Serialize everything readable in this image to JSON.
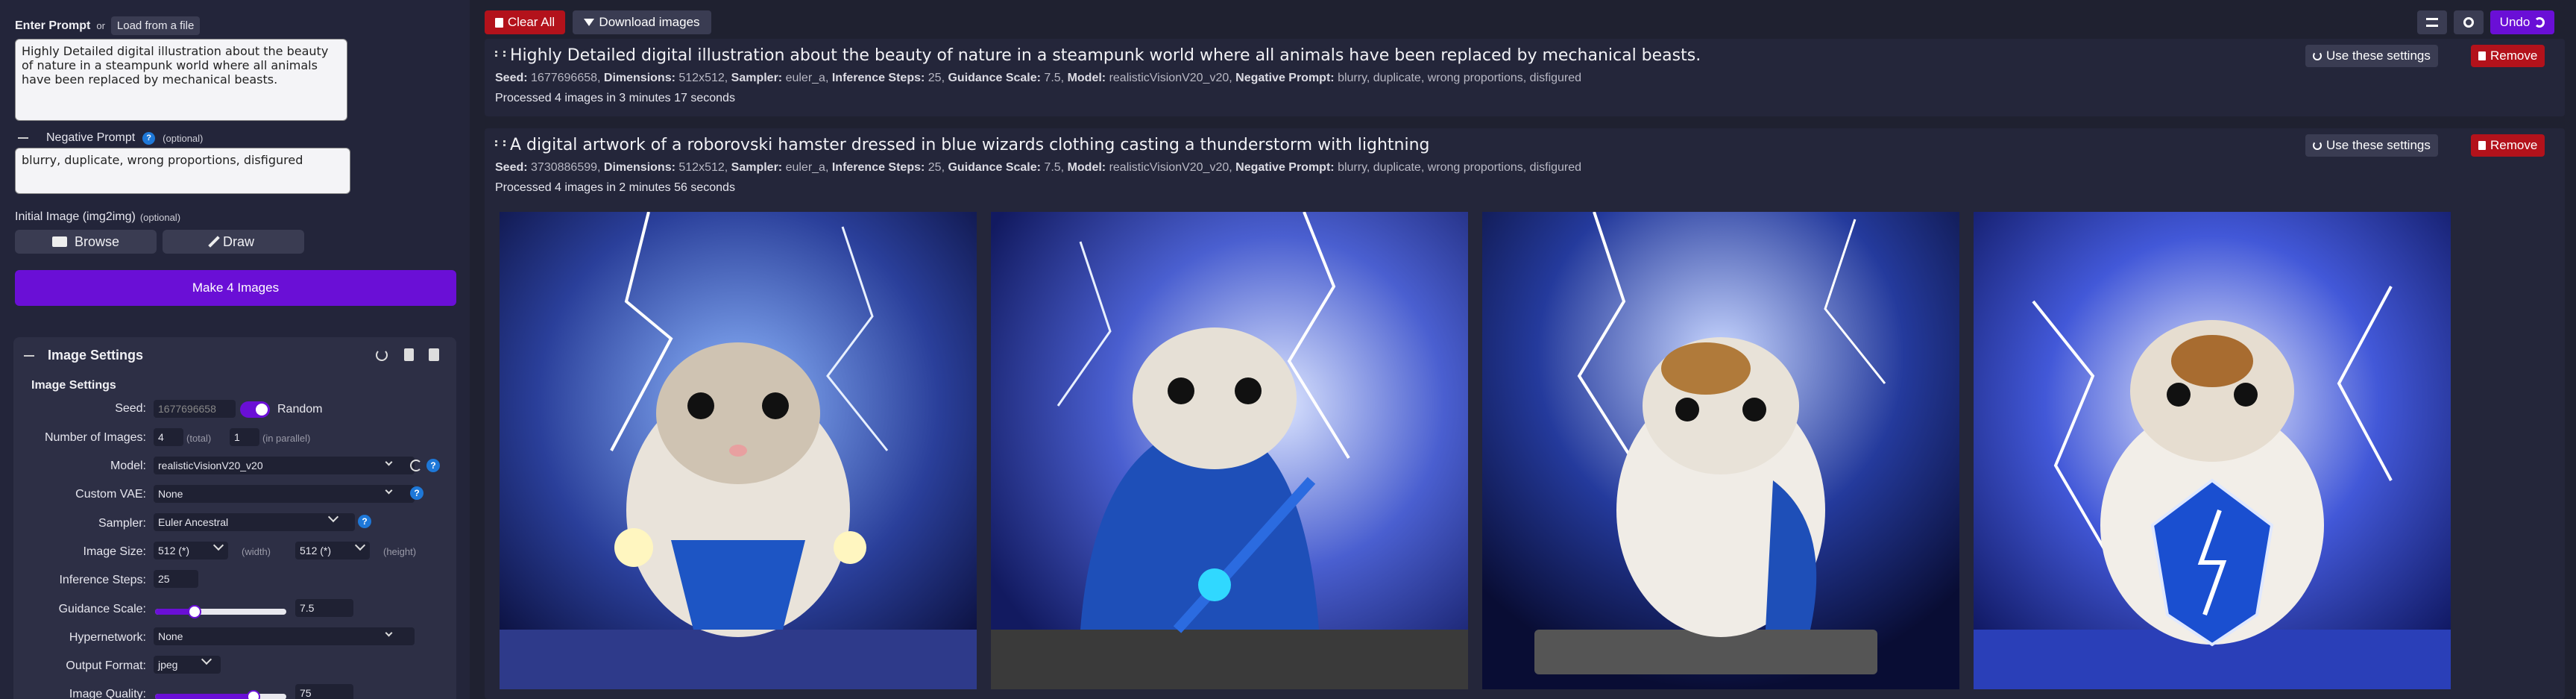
{
  "prompt": {
    "label": "Enter Prompt",
    "or": "or",
    "load_file": "Load from a file",
    "text": "Highly Detailed digital illustration about the beauty of nature in a steampunk world where all animals have been replaced by mechanical beasts."
  },
  "negative_prompt": {
    "label": "Negative Prompt",
    "optional": "(optional)",
    "text": "blurry, duplicate, wrong proportions, disfigured"
  },
  "init_image": {
    "label": "Initial Image (img2img)",
    "optional": "(optional)",
    "browse": "Browse",
    "draw": "Draw"
  },
  "make_button": "Make 4 Images",
  "image_settings": {
    "header": "Image Settings",
    "subheader": "Image Settings",
    "seed": {
      "label": "Seed:",
      "value": "1677696658",
      "toggle_label": "Random",
      "random_on": true
    },
    "num_images": {
      "label": "Number of Images:",
      "total": "4",
      "total_hint": "(total)",
      "parallel": "1",
      "parallel_hint": "(in parallel)"
    },
    "model": {
      "label": "Model:",
      "value": "realisticVisionV20_v20"
    },
    "vae": {
      "label": "Custom VAE:",
      "value": "None"
    },
    "sampler": {
      "label": "Sampler:",
      "value": "Euler Ancestral"
    },
    "size": {
      "label": "Image Size:",
      "width": "512 (*)",
      "width_hint": "(width)",
      "height": "512 (*)",
      "height_hint": "(height)"
    },
    "steps": {
      "label": "Inference Steps:",
      "value": "25"
    },
    "guidance": {
      "label": "Guidance Scale:",
      "value": "7.5",
      "fraction": 0.3
    },
    "hypernetwork": {
      "label": "Hypernetwork:",
      "value": "None"
    },
    "output_format": {
      "label": "Output Format:",
      "value": "jpeg"
    },
    "quality": {
      "label": "Image Quality:",
      "value": "75",
      "fraction": 0.75
    }
  },
  "toolbar": {
    "clear_all": "Clear All",
    "download": "Download images",
    "undo": "Undo"
  },
  "tasks": [
    {
      "title": "Highly Detailed digital illustration about the beauty of nature in a steampunk world where all animals have been replaced by mechanical beasts.",
      "seed_label": "Seed:",
      "seed": "1677696658",
      "dim_label": "Dimensions:",
      "dim": "512x512",
      "sampler_label": "Sampler:",
      "sampler": "euler_a",
      "steps_label": "Inference Steps:",
      "steps": "25",
      "guidance_label": "Guidance Scale:",
      "guidance": "7.5",
      "model_label": "Model:",
      "model": "realisticVisionV20_v20",
      "neg_label": "Negative Prompt:",
      "neg": "blurry, duplicate, wrong proportions, disfigured",
      "status": "Processed 4 images in 3 minutes 17 seconds",
      "use_settings": "Use these settings",
      "remove": "Remove"
    },
    {
      "title": "A digital artwork of a roborovski hamster dressed in blue wizards clothing casting a thunderstorm with lightning",
      "seed_label": "Seed:",
      "seed": "3730886599",
      "dim_label": "Dimensions:",
      "dim": "512x512",
      "sampler_label": "Sampler:",
      "sampler": "euler_a",
      "steps_label": "Inference Steps:",
      "steps": "25",
      "guidance_label": "Guidance Scale:",
      "guidance": "7.5",
      "model_label": "Model:",
      "model": "realisticVisionV20_v20",
      "neg_label": "Negative Prompt:",
      "neg": "blurry, duplicate, wrong proportions, disfigured",
      "status": "Processed 4 images in 2 minutes 56 seconds",
      "use_settings": "Use these settings",
      "remove": "Remove"
    }
  ],
  "colors": {
    "accent": "#6a0fd6",
    "danger": "#b3121b",
    "info": "#1e78d8"
  }
}
